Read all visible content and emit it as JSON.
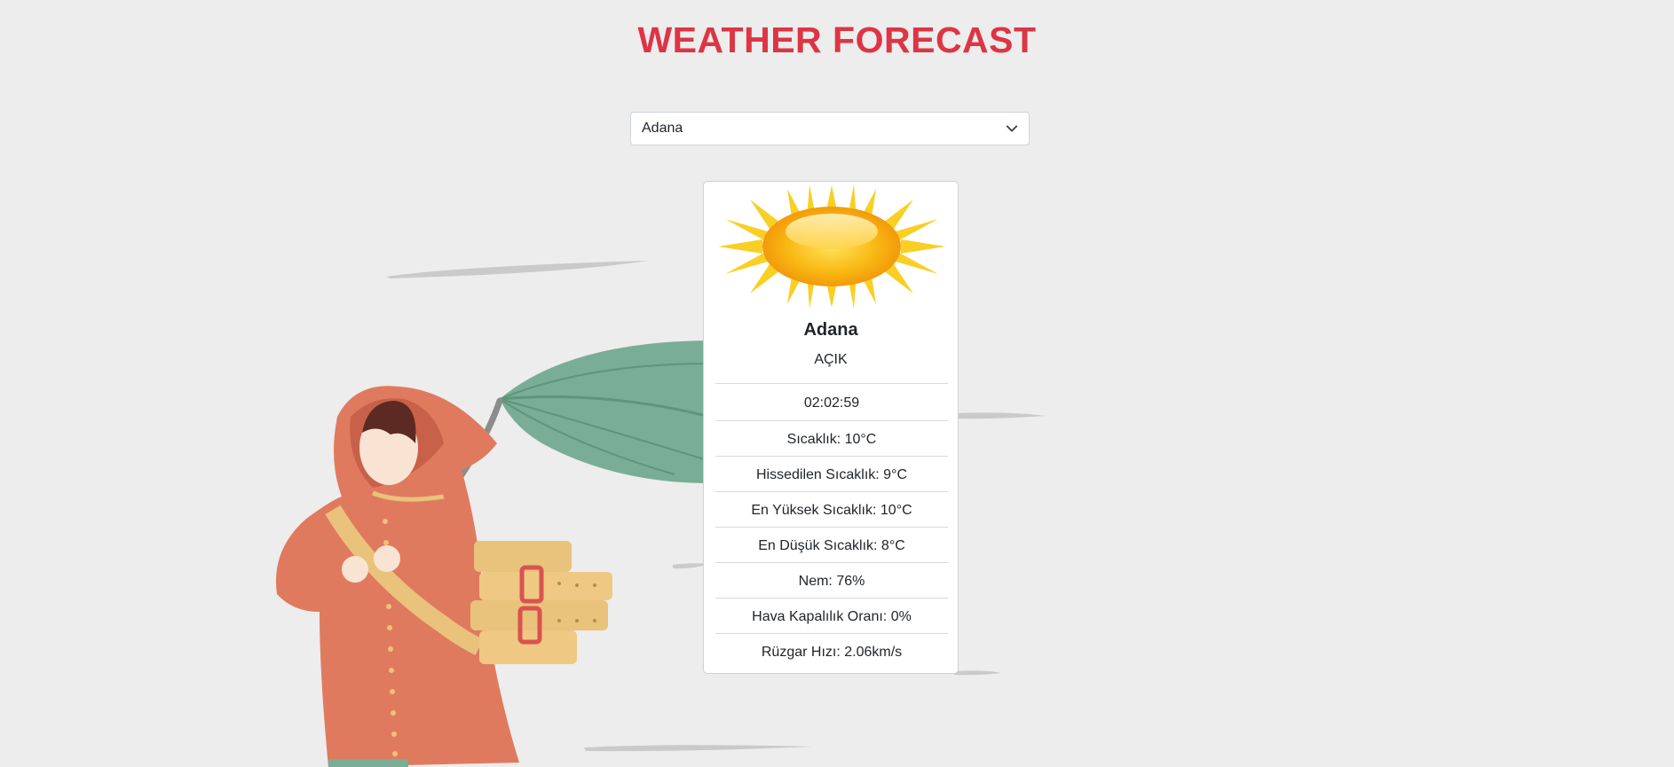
{
  "page": {
    "title": "WEATHER FORECAST"
  },
  "city_select": {
    "selected": "Adana"
  },
  "weather_card": {
    "city": "Adana",
    "description": "AÇIK",
    "weather_icon": "sun-icon",
    "time": "02:02:59",
    "temperature": "Sıcaklık: 10°C",
    "feels_like": "Hissedilen Sıcaklık: 9°C",
    "temp_max": "En Yüksek Sıcaklık: 10°C",
    "temp_min": "En Düşük Sıcaklık: 8°C",
    "humidity": "Nem: 76%",
    "cloudiness": "Hava Kapalılık Oranı: 0%",
    "wind_speed": "Rüzgar Hızı: 2.06km/s"
  },
  "colors": {
    "background": "#ecedec",
    "title": "#dc3545",
    "card_background": "#ffffff",
    "coat": "#e07a5f",
    "leaf": "#7aad95",
    "bag": "#e9c27c",
    "sun": "#f6b619"
  }
}
